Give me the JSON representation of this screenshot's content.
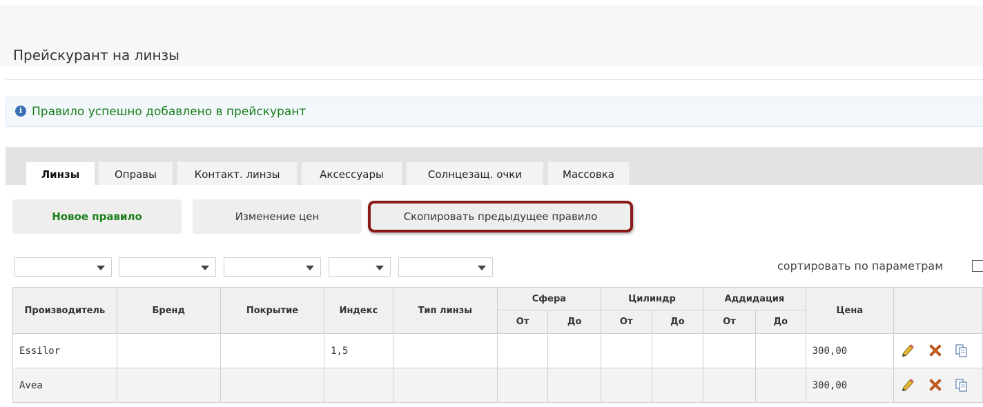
{
  "page": {
    "title": "Прейскурант на линзы"
  },
  "notice": {
    "icon": "info-icon",
    "text": "Правило успешно добавлено в прейскурант"
  },
  "tabs": [
    {
      "label": "Линзы",
      "active": true
    },
    {
      "label": "Оправы"
    },
    {
      "label": "Контакт. линзы"
    },
    {
      "label": "Аксессуары"
    },
    {
      "label": "Солнцезащ. очки"
    },
    {
      "label": "Массовка"
    }
  ],
  "actions": {
    "new_rule": "Новое правило",
    "change_prices": "Изменение цен",
    "copy_previous": "Скопировать предыдущее правило"
  },
  "filters": {
    "count": 5,
    "sort_label": "сортировать по параметрам"
  },
  "table": {
    "headers": {
      "manufacturer": "Производитель",
      "brand": "Бренд",
      "coating": "Покрытие",
      "index": "Индекс",
      "lens_type": "Тип линзы",
      "sphere": "Сфера",
      "cylinder": "Цилиндр",
      "addition": "Аддидация",
      "price": "Цена",
      "from": "От",
      "to": "До"
    },
    "rows": [
      {
        "manufacturer": "Essilor",
        "brand": "",
        "coating": "",
        "index": "1,5",
        "lens_type": "",
        "sph_from": "",
        "sph_to": "",
        "cyl_from": "",
        "cyl_to": "",
        "add_from": "",
        "add_to": "",
        "price": "300,00"
      },
      {
        "manufacturer": "Avea",
        "brand": "",
        "coating": "",
        "index": "",
        "lens_type": "",
        "sph_from": "",
        "sph_to": "",
        "cyl_from": "",
        "cyl_to": "",
        "add_from": "",
        "add_to": "",
        "price": "300,00"
      }
    ],
    "row_icons": [
      "pencil-icon",
      "delete-icon",
      "copy-icon"
    ]
  },
  "colors": {
    "success_text": "#1a7f1a",
    "highlight_border": "#8a1a1a",
    "info_icon": "#3a6fb5",
    "delete_icon": "#d4611a"
  }
}
